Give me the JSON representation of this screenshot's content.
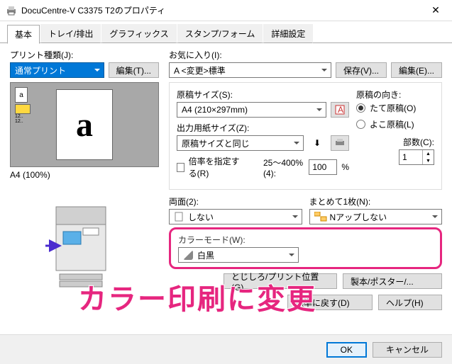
{
  "window": {
    "title": "DocuCentre-V C3375 T2のプロパティ"
  },
  "tabs": [
    "基本",
    "トレイ/排出",
    "グラフィックス",
    "スタンプ/フォーム",
    "詳細設定"
  ],
  "left": {
    "printTypeLabel": "プリント種類(J):",
    "printType": "通常プリント",
    "editBtn": "編集(T)...",
    "previewLabel": "A4 (100%)"
  },
  "fav": {
    "label": "お気に入り(I):",
    "value": "A <変更>標準",
    "save": "保存(V)...",
    "edit": "編集(E)..."
  },
  "size": {
    "origLabel": "原稿サイズ(S):",
    "orig": "A4 (210×297mm)",
    "outLabel": "出力用紙サイズ(Z):",
    "out": "原稿サイズと同じ",
    "scaleChk": "倍率を指定する(R)",
    "scaleRange": "25～400%(4):",
    "scaleVal": "100",
    "pct": "%"
  },
  "orient": {
    "label": "原稿の向き:",
    "portrait": "たて原稿(O)",
    "landscape": "よこ原稿(L)"
  },
  "copies": {
    "label": "部数(C):",
    "val": "1"
  },
  "duplex": {
    "label": "両面(2):",
    "val": "しない"
  },
  "nup": {
    "label": "まとめて1枚(N):",
    "val": "Nアップしない"
  },
  "color": {
    "label": "カラーモード(W):",
    "val": "白黒"
  },
  "btns": {
    "binding": "とじしろ/プリント位置(G)...",
    "booklet": "製本/ポスター/...",
    "defaults": "標準に戻す(D)",
    "help": "ヘルプ(H)"
  },
  "footer": {
    "ok": "OK",
    "cancel": "キャンセル"
  },
  "annotation": "カラー印刷に変更"
}
